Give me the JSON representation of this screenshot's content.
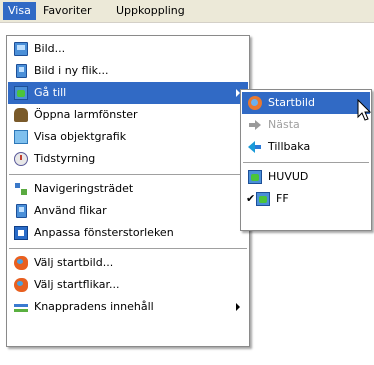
{
  "menubar": {
    "items": [
      {
        "label": "Visa"
      },
      {
        "label": "Favoriter"
      },
      {
        "label": "Uppkoppling"
      }
    ]
  },
  "visa_menu": {
    "items": [
      {
        "label": "Bild...",
        "icon": "picture-icon"
      },
      {
        "label": "Bild i ny flik...",
        "icon": "picture-tab-icon"
      },
      {
        "label": "Gå till",
        "icon": "goto-icon",
        "submenu": true,
        "highlighted": true
      },
      {
        "label": "Öppna larmfönster",
        "icon": "alarm-icon"
      },
      {
        "label": "Visa objektgrafik",
        "icon": "object-graphics-icon"
      },
      {
        "label": "Tidstyrning",
        "icon": "clock-icon"
      },
      {
        "label": "Navigeringsträdet",
        "icon": "navigation-tree-icon"
      },
      {
        "label": "Använd flikar",
        "icon": "tabs-icon"
      },
      {
        "label": "Anpassa fönsterstorleken",
        "icon": "resize-window-icon"
      },
      {
        "label": "Välj startbild...",
        "icon": "start-picture-icon"
      },
      {
        "label": "Välj startflikar...",
        "icon": "start-tabs-icon"
      },
      {
        "label": "Knappradens innehåll",
        "icon": "toolbar-icon",
        "submenu": true
      }
    ]
  },
  "goto_submenu": {
    "items": [
      {
        "label": "Startbild",
        "icon": "start-picture-icon",
        "highlighted": true
      },
      {
        "label": "Nästa",
        "icon": "next-arrow-icon",
        "disabled": true
      },
      {
        "label": "Tillbaka",
        "icon": "back-arrow-icon"
      },
      {
        "label": "HUVUD",
        "icon": "picture-icon"
      },
      {
        "label": "FF",
        "icon": "picture-icon",
        "checked": true
      }
    ]
  },
  "colors": {
    "highlight": "#316ac5",
    "menubar_bg": "#ece9d8",
    "menu_bg": "#ffffff",
    "disabled_text": "#a0a0a0"
  }
}
